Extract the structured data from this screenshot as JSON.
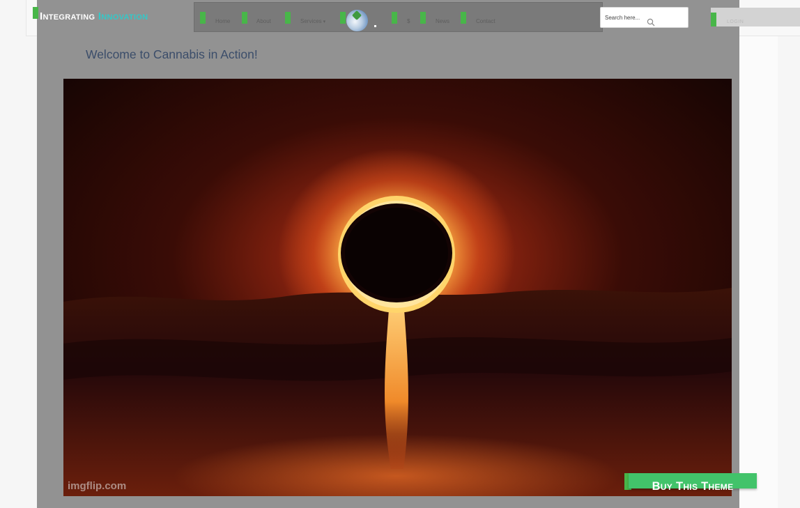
{
  "site": {
    "brand_part1": "Integrating ",
    "brand_part2": "Innovation",
    "brand_accent_color": "#34c8c8",
    "marker_color": "#48b649"
  },
  "nav": {
    "items": [
      {
        "label": "Home"
      },
      {
        "label": "About"
      },
      {
        "label": "Services"
      },
      {
        "label": "$"
      },
      {
        "label": "News"
      },
      {
        "label": "Contact"
      }
    ],
    "logo_icon": "cannabis-leaf-logo-icon"
  },
  "search": {
    "placeholder": "Search here...",
    "icon": "search-icon"
  },
  "login": {
    "label": "LOGIN"
  },
  "main": {
    "welcome": "Welcome to Cannabis in Action!",
    "hero_watermark": "imgflip.com"
  },
  "cta": {
    "label": "Buy This Theme",
    "color": "#42c36a"
  }
}
